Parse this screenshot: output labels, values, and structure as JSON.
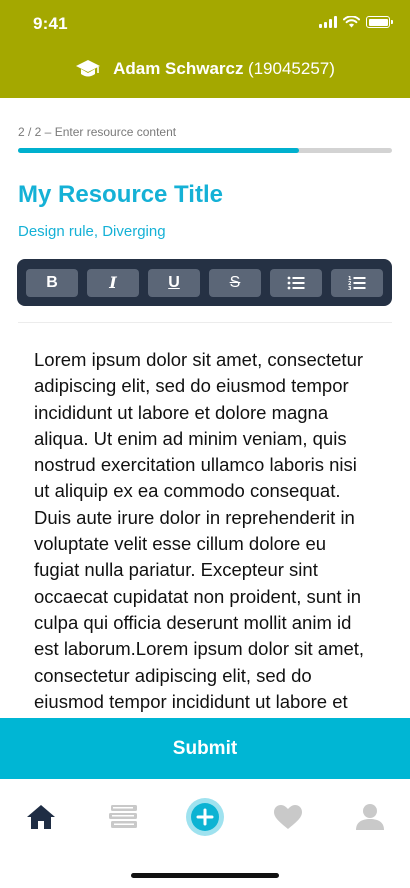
{
  "status": {
    "time": "9:41"
  },
  "header": {
    "user_name": "Adam Schwarcz",
    "user_id": "(19045257)",
    "bg_color": "#a4a800",
    "icon": "graduation-cap-icon"
  },
  "progress": {
    "step_label": "2 / 2 – Enter resource content",
    "value": 0.75,
    "color": "#00b0ce"
  },
  "resource": {
    "title": "My Resource Title",
    "tags": "Design rule, Diverging"
  },
  "toolbar": {
    "bold": "B",
    "italic": "I",
    "underline": "U",
    "strikethrough": "S",
    "bullet_list_icon": "bullet-list-icon",
    "numbered_list_icon": "numbered-list-icon"
  },
  "editor": {
    "content": "Lorem ipsum dolor sit amet, consectetur adipiscing elit, sed do eiusmod tempor incididunt ut labore et dolore magna aliqua. Ut enim ad minim veniam, quis nostrud exercitation ullamco laboris nisi ut aliquip ex ea commodo consequat. Duis aute irure dolor in reprehenderit in voluptate velit esse cillum dolore eu fugiat nulla pariatur. Excepteur sint occaecat cupidatat non proident, sunt in culpa qui officia deserunt mollit anim id est laborum.Lorem ipsum dolor sit amet, consectetur adipiscing elit, sed do eiusmod tempor incididunt ut labore et dolore magna aliqua."
  },
  "submit": {
    "label": "Submit",
    "color": "#00b6d4"
  },
  "tabbar": {
    "items": [
      "home-icon",
      "books-icon",
      "add-icon",
      "heart-icon",
      "profile-icon"
    ],
    "active": "home-icon"
  }
}
